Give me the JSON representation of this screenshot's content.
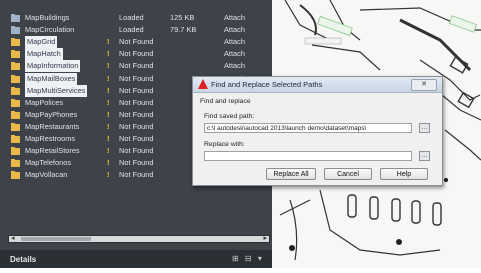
{
  "xrefs": [
    {
      "name": "MapBuildings",
      "status": "Loaded",
      "size": "125 KB",
      "type": "Attach",
      "missing": false,
      "selected": false,
      "icon": "drawing-file-icon"
    },
    {
      "name": "MapCirculation",
      "status": "Loaded",
      "size": "79.7 KB",
      "type": "Attach",
      "missing": false,
      "selected": false,
      "icon": "drawing-file-icon"
    },
    {
      "name": "MapGrid",
      "status": "Not Found",
      "size": "",
      "type": "Attach",
      "missing": true,
      "selected": true,
      "icon": "folder-icon"
    },
    {
      "name": "MapHatch",
      "status": "Not Found",
      "size": "",
      "type": "Attach",
      "missing": true,
      "selected": true,
      "icon": "folder-icon"
    },
    {
      "name": "MapInformation",
      "status": "Not Found",
      "size": "",
      "type": "Attach",
      "missing": true,
      "selected": true,
      "icon": "folder-icon"
    },
    {
      "name": "MapMailBoxes",
      "status": "Not Found",
      "size": "",
      "type": "Attach",
      "missing": true,
      "selected": true,
      "icon": "folder-icon"
    },
    {
      "name": "MapMultiServices",
      "status": "Not Found",
      "size": "",
      "type": "Attach",
      "missing": true,
      "selected": true,
      "icon": "folder-icon"
    },
    {
      "name": "MapPolices",
      "status": "Not Found",
      "size": "",
      "type": "",
      "missing": true,
      "selected": false,
      "icon": "folder-icon"
    },
    {
      "name": "MapPayPhones",
      "status": "Not Found",
      "size": "",
      "type": "",
      "missing": true,
      "selected": false,
      "icon": "folder-icon"
    },
    {
      "name": "MapRestaurants",
      "status": "Not Found",
      "size": "",
      "type": "",
      "missing": true,
      "selected": false,
      "icon": "folder-icon"
    },
    {
      "name": "MapRestrooms",
      "status": "Not Found",
      "size": "",
      "type": "",
      "missing": true,
      "selected": false,
      "icon": "folder-icon"
    },
    {
      "name": "MapRetailStores",
      "status": "Not Found",
      "size": "",
      "type": "",
      "missing": true,
      "selected": false,
      "icon": "folder-icon"
    },
    {
      "name": "MapTelefonos",
      "status": "Not Found",
      "size": "",
      "type": "",
      "missing": true,
      "selected": false,
      "icon": "folder-icon"
    },
    {
      "name": "MapVollacan",
      "status": "Not Found",
      "size": "",
      "type": "",
      "missing": true,
      "selected": false,
      "icon": "folder-icon"
    }
  ],
  "missing_marker": "!",
  "details": {
    "label": "Details",
    "tools": "⊞ ⊟ ▾"
  },
  "dialog": {
    "title": "Find and Replace Selected Paths",
    "close": "✕",
    "find_label": "Find and replace",
    "find_saved_label": "Find saved path:",
    "find_saved_value": "c:\\l autodesk\\autocad 2013\\launch demo\\dataset\\maps\\",
    "replace_label": "Replace with:",
    "replace_value": "",
    "browse": "…",
    "buttons": {
      "replace_all": "Replace All",
      "cancel": "Cancel",
      "help": "Help"
    }
  },
  "colors": {
    "palette_bg": "#3d4349",
    "folder": "#e9b949",
    "selection": "#eef1f4",
    "warning": "#f2c230",
    "autocad_red": "#d22"
  }
}
